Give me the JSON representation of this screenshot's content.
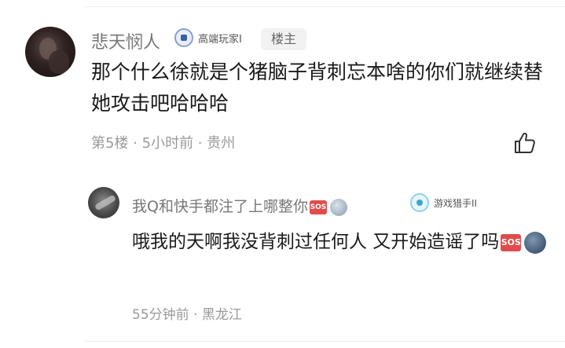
{
  "comment": {
    "username": "悲天悯人",
    "badge_label": "高端玩家I",
    "op_tag": "楼主",
    "text": "那个什么徐就是个猪脑子背刺忘本啥的你们就继续替她攻击吧哈哈哈",
    "meta": "第5楼 · 5小时前 · 贵州"
  },
  "reply": {
    "username": "我Q和快手都注了上哪整你",
    "badge_label": "游戏猎手II",
    "text": "哦我的天啊我没背刺过任何人 又开始造谣了吗",
    "meta": "55分钟前 · 黑龙江",
    "emoji_sos": "SOS"
  },
  "icons": {
    "like": "thumbs-up-icon",
    "sos": "sos-emoji-icon",
    "moon": "new-moon-face-icon"
  },
  "colors": {
    "meta_gray": "#9a9a9a",
    "username_gray": "#777777",
    "sos_red": "#e24b4b"
  }
}
